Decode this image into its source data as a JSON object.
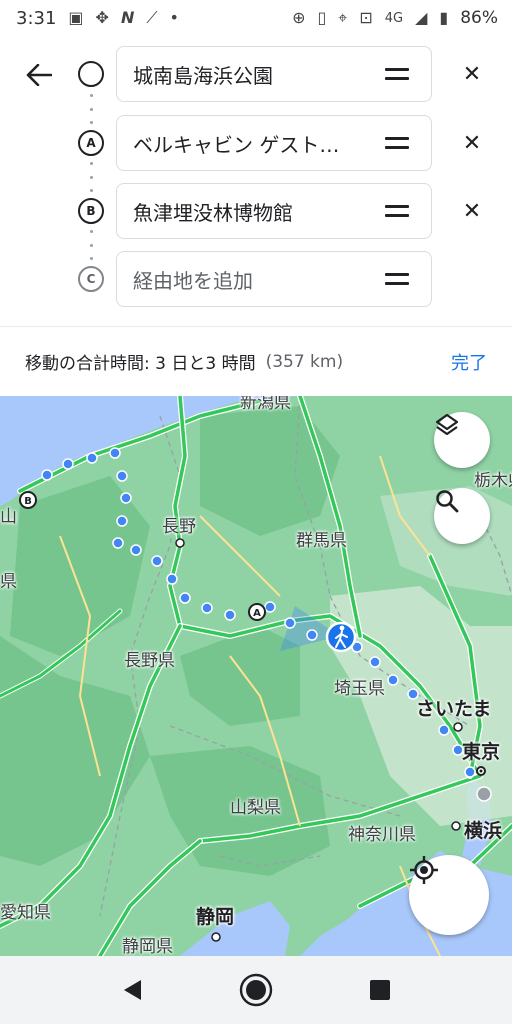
{
  "status_bar": {
    "time": "3:31",
    "network": "4G",
    "battery": "86%",
    "icons": [
      "image-icon",
      "slack-icon",
      "n-app-icon",
      "satellite-icon",
      "dot-icon",
      "data-saver-icon",
      "vibrate-icon",
      "location-icon",
      "voicemail-icon",
      "signal-icon",
      "battery-icon"
    ]
  },
  "route": {
    "stops": [
      {
        "marker": "",
        "value": "城南島海浜公園",
        "removable": true
      },
      {
        "marker": "A",
        "value": "ベルキャビン ゲスト…",
        "removable": true
      },
      {
        "marker": "B",
        "value": "魚津埋没林博物館",
        "removable": true
      },
      {
        "marker": "C",
        "placeholder": "経由地を追加",
        "removable": false
      }
    ]
  },
  "summary": {
    "total_time": "移動の合計時間: 3 日と3 時間",
    "distance": "(357 km)",
    "done_label": "完了"
  },
  "map": {
    "labels": {
      "niigata": "新潟県",
      "tochigi": "栃木県",
      "nagano_city": "長野",
      "gunma": "群馬県",
      "edge_left": "山",
      "pref_left": "県",
      "nagano_pref": "長野県",
      "saitama_pref": "埼玉県",
      "saitama_city": "さいたま",
      "tokyo": "東京",
      "yamanashi": "山梨県",
      "kanagawa": "神奈川県",
      "yokohama": "横浜",
      "aichi": "愛知県",
      "shizuoka_city": "静岡",
      "shizuoka_pref": "静岡県"
    },
    "route_markers": {
      "a": "A",
      "b": "B"
    },
    "colors": {
      "land": "#8fd3a4",
      "sea": "#a8c7fa",
      "mountain": "#76c58f",
      "highway": "#ffffff",
      "traffic": "#34c759",
      "route_dot": "#4285f4",
      "walk_marker": "#1a73e8"
    }
  },
  "nav_bar": {
    "icons": [
      "back-triangle-icon",
      "home-circle-icon",
      "recents-square-icon"
    ]
  }
}
